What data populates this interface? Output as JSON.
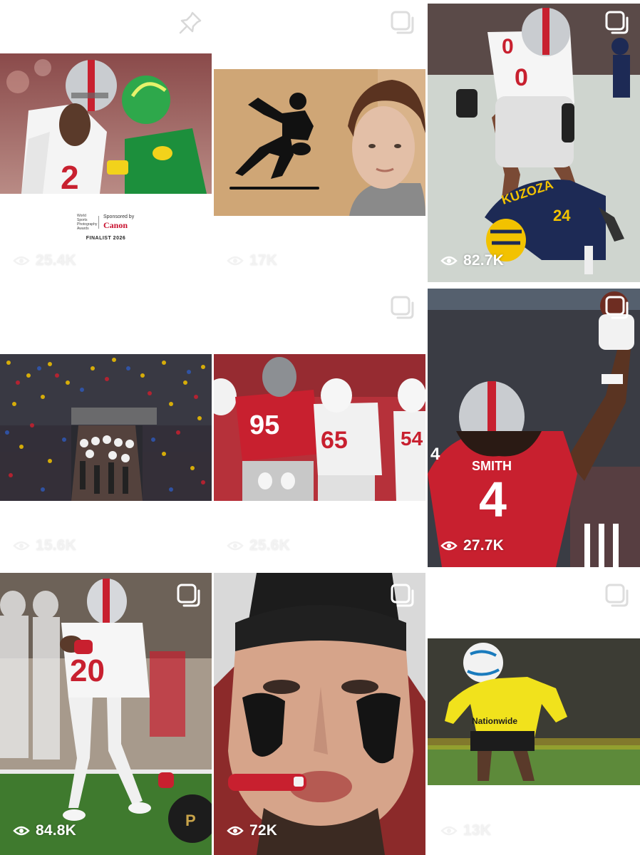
{
  "grid": {
    "tiles": [
      {
        "views": "25.4K",
        "badge": "pin-icon",
        "caption": "FINALIST 2026",
        "sponsor": {
          "org": "World Sports Photography Awards",
          "sponsored_by": "Sponsored by",
          "brand": "Canon"
        }
      },
      {
        "views": "17K",
        "badge": "stack-icon"
      },
      {
        "views": "82.7K",
        "badge": "stack-icon",
        "jersey_a": "0",
        "jersey_b": "24",
        "name_b": "KUZOZA"
      },
      {
        "views": "15.6K",
        "badge": "none"
      },
      {
        "views": "25.6K",
        "badge": "stack-icon",
        "jersey_a": "95",
        "jersey_b": "65",
        "jersey_c": "54"
      },
      {
        "views": "27.7K",
        "badge": "stack-icon",
        "jersey_a": "4",
        "name_a": "SMITH"
      },
      {
        "views": "84.8K",
        "badge": "stack-icon",
        "jersey_a": "20"
      },
      {
        "views": "72K",
        "badge": "stack-icon"
      },
      {
        "views": "13K",
        "badge": "stack-icon",
        "sponsor_text": "Nationwide"
      }
    ]
  },
  "colors": {
    "scarlet": "#c8202f",
    "gray": "#bfc3c7",
    "michigan_blue": "#1d2a55",
    "maize": "#f2c200",
    "crew_yellow": "#f1e21c",
    "oregon_green": "#1c8f3c"
  }
}
